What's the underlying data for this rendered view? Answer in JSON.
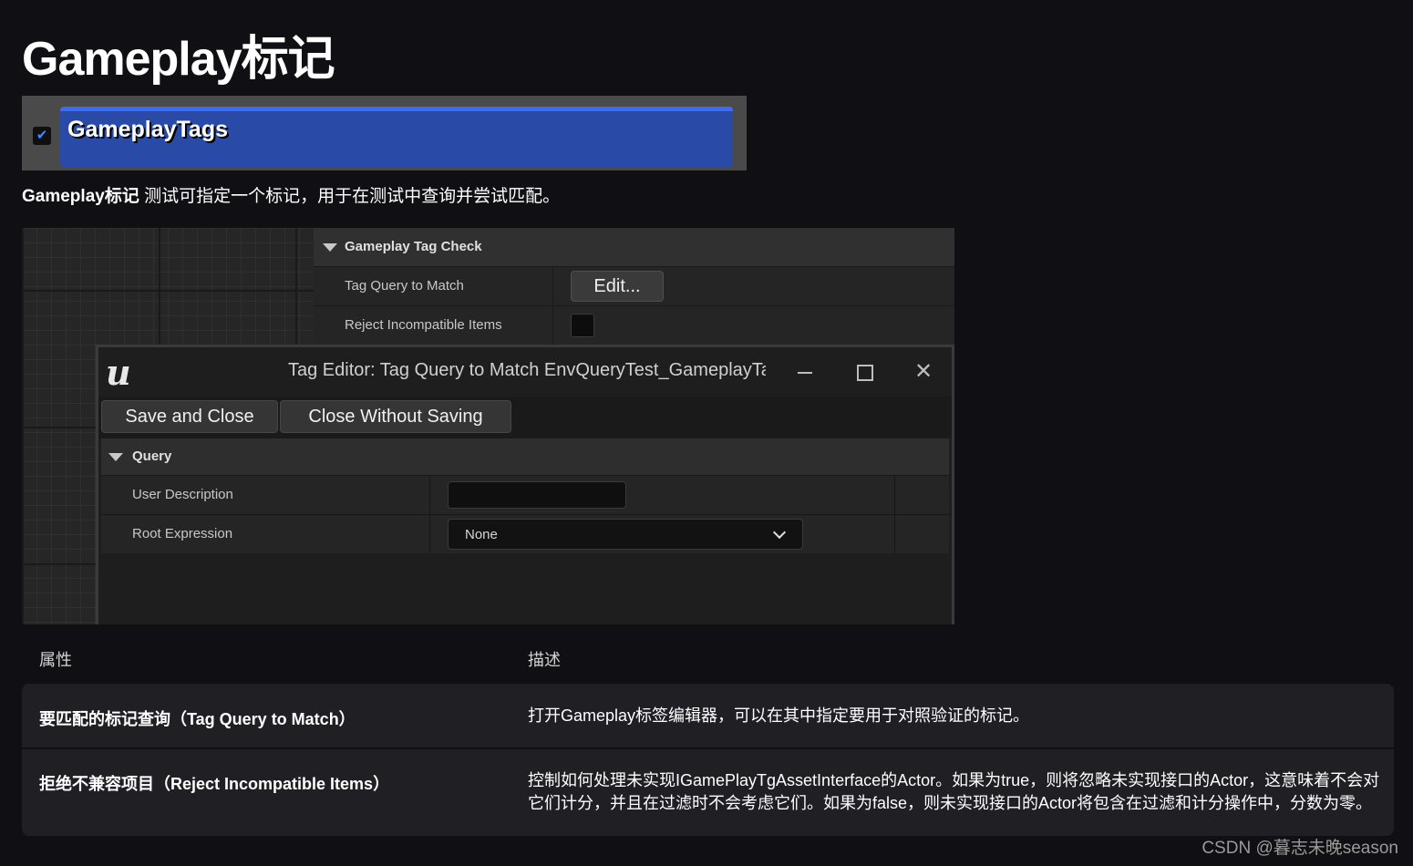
{
  "page": {
    "title": "Gameplay标记",
    "intro_bold": "Gameplay标记",
    "intro_rest": " 测试可指定一个标记，用于在测试中查询并尝试匹配。",
    "watermark": "CSDN @暮志未晚season"
  },
  "node_header": {
    "checkbox_glyph": "✔",
    "label": "GameplayTags",
    "bar_color": "#2a4aa8"
  },
  "details_panel": {
    "section_label": "Gameplay Tag Check",
    "rows": [
      {
        "label": "Tag Query to Match",
        "button_label": "Edit..."
      },
      {
        "label": "Reject Incompatible Items"
      }
    ]
  },
  "tag_editor": {
    "logo_glyph": "u",
    "title": "Tag Editor: Tag Query to Match EnvQueryTest_GameplayTags",
    "close_glyph": "✕",
    "toolbar": {
      "save_label": "Save and Close",
      "close_label": "Close Without Saving"
    },
    "section_label": "Query",
    "rows": [
      {
        "label": "User Description",
        "value": ""
      },
      {
        "label": "Root Expression",
        "value": "None"
      }
    ]
  },
  "properties_table": {
    "headers": [
      "属性",
      "描述"
    ],
    "rows": [
      {
        "name": "要匹配的标记查询（Tag Query to Match）",
        "description": "打开Gameplay标签编辑器，可以在其中指定要用于对照验证的标记。"
      },
      {
        "name": "拒绝不兼容项目（Reject Incompatible Items）",
        "description": "控制如何处理未实现IGamePlayTgAssetInterface的Actor。如果为true，则将忽略未实现接口的Actor，这意味着不会对它们计分，并且在过滤时不会考虑它们。如果为false，则未实现接口的Actor将包含在过滤和计分操作中，分数为零。"
      }
    ]
  }
}
